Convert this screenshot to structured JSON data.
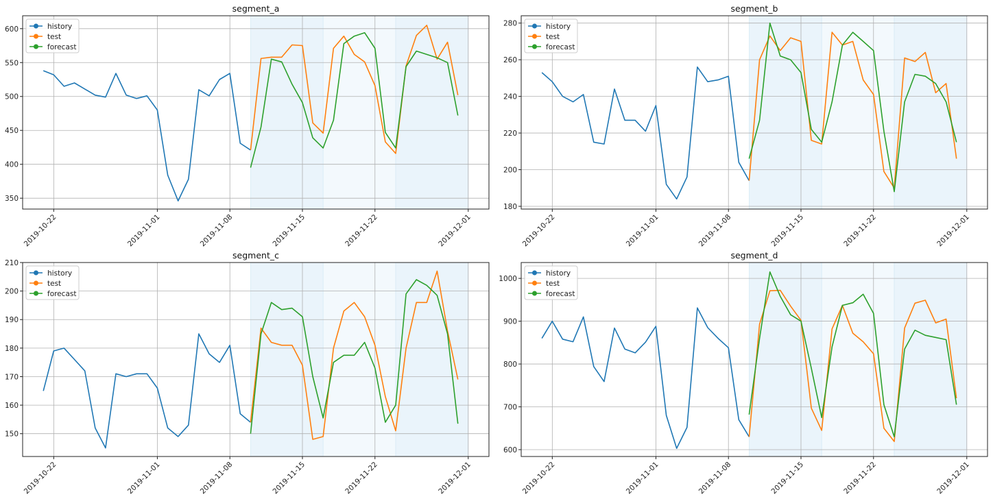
{
  "colors": {
    "history": "#1f77b4",
    "test": "#ff7f0e",
    "forecast": "#2ca02c",
    "fold_a": "#eaf4fb",
    "fold_b": "#f3f9fd",
    "grid": "#b0b0b0"
  },
  "chart_data": [
    {
      "type": "line",
      "title": "segment_a",
      "xlim": [
        "2019-10-19",
        "2019-12-03"
      ],
      "ylim": [
        334,
        619
      ],
      "xticks": [
        "2019-10-22",
        "2019-11-01",
        "2019-11-08",
        "2019-11-15",
        "2019-11-22",
        "2019-12-01"
      ],
      "yticks": [
        350,
        400,
        450,
        500,
        550,
        600
      ],
      "grid": true,
      "legend": "top-left",
      "folds": [
        [
          "2019-11-10",
          "2019-11-17"
        ],
        [
          "2019-11-17",
          "2019-11-24"
        ],
        [
          "2019-11-24",
          "2019-12-01"
        ]
      ],
      "series": [
        {
          "name": "history",
          "start": "2019-10-21",
          "values": [
            538,
            532,
            515,
            520,
            511,
            502,
            499,
            534,
            502,
            497,
            501,
            480,
            384,
            346,
            378,
            510,
            501,
            525,
            534,
            431,
            421
          ]
        },
        {
          "name": "test",
          "start": "2019-11-10",
          "values": [
            421,
            556,
            558,
            558,
            576,
            575,
            461,
            446,
            571,
            589,
            562,
            551,
            516,
            433,
            416,
            545,
            590,
            605,
            555,
            580,
            502
          ]
        },
        {
          "name": "forecast",
          "start": "2019-11-10",
          "values": [
            395,
            455,
            555,
            551,
            518,
            491,
            439,
            424,
            465,
            578,
            589,
            594,
            571,
            447,
            424,
            544,
            567,
            562,
            557,
            550,
            472
          ]
        }
      ]
    },
    {
      "type": "line",
      "title": "segment_b",
      "xlim": [
        "2019-10-19",
        "2019-12-03"
      ],
      "ylim": [
        178.5,
        284
      ],
      "xticks": [
        "2019-10-22",
        "2019-11-01",
        "2019-11-08",
        "2019-11-15",
        "2019-11-22",
        "2019-12-01"
      ],
      "yticks": [
        180,
        200,
        220,
        240,
        260,
        280
      ],
      "grid": true,
      "legend": "top-left",
      "folds": [
        [
          "2019-11-10",
          "2019-11-17"
        ],
        [
          "2019-11-17",
          "2019-11-24"
        ],
        [
          "2019-11-24",
          "2019-12-01"
        ]
      ],
      "series": [
        {
          "name": "history",
          "start": "2019-10-21",
          "values": [
            253,
            248,
            240,
            237,
            241,
            215,
            214,
            244,
            227,
            227,
            221,
            235,
            192,
            184,
            196,
            256,
            248,
            249,
            251,
            204,
            194
          ]
        },
        {
          "name": "test",
          "start": "2019-11-10",
          "values": [
            194,
            260,
            273,
            265,
            272,
            270,
            216,
            214,
            275,
            268,
            270,
            249,
            241,
            199,
            190,
            261,
            259,
            264,
            242,
            247,
            206
          ]
        },
        {
          "name": "forecast",
          "start": "2019-11-10",
          "values": [
            206,
            227,
            280,
            262,
            260,
            253,
            222,
            215,
            237,
            268,
            275,
            270,
            265,
            221,
            188,
            237,
            252,
            251,
            247,
            237,
            215
          ]
        }
      ]
    },
    {
      "type": "line",
      "title": "segment_c",
      "xlim": [
        "2019-10-19",
        "2019-12-03"
      ],
      "ylim": [
        142,
        210
      ],
      "xticks": [
        "2019-10-22",
        "2019-11-01",
        "2019-11-08",
        "2019-11-15",
        "2019-11-22",
        "2019-12-01"
      ],
      "yticks": [
        150,
        160,
        170,
        180,
        190,
        200,
        210
      ],
      "grid": true,
      "legend": "top-left",
      "folds": [
        [
          "2019-11-10",
          "2019-11-17"
        ],
        [
          "2019-11-17",
          "2019-11-24"
        ],
        [
          "2019-11-24",
          "2019-12-01"
        ]
      ],
      "series": [
        {
          "name": "history",
          "start": "2019-10-21",
          "values": [
            165,
            179,
            180,
            176,
            172,
            152,
            145,
            171,
            170,
            171,
            171,
            166,
            152,
            149,
            153,
            185,
            178,
            175,
            181,
            157,
            154
          ]
        },
        {
          "name": "test",
          "start": "2019-11-10",
          "values": [
            154,
            187,
            182,
            181,
            181,
            174,
            148,
            149,
            180,
            193,
            196,
            191,
            181,
            163,
            151,
            180,
            196,
            196,
            207,
            186,
            169
          ]
        },
        {
          "name": "forecast",
          "start": "2019-11-10",
          "values": [
            150,
            185,
            196,
            193.5,
            194,
            191,
            170,
            155.5,
            175,
            177.5,
            177.5,
            182,
            173,
            154,
            160,
            199,
            204,
            202,
            198.5,
            185,
            153.5
          ]
        }
      ]
    },
    {
      "type": "line",
      "title": "segment_d",
      "xlim": [
        "2019-10-19",
        "2019-12-03"
      ],
      "ylim": [
        584,
        1037
      ],
      "xticks": [
        "2019-10-22",
        "2019-11-01",
        "2019-11-08",
        "2019-11-15",
        "2019-11-22",
        "2019-12-01"
      ],
      "yticks": [
        600,
        700,
        800,
        900,
        1000
      ],
      "grid": true,
      "legend": "top-left",
      "folds": [
        [
          "2019-11-10",
          "2019-11-17"
        ],
        [
          "2019-11-17",
          "2019-11-24"
        ],
        [
          "2019-11-24",
          "2019-12-01"
        ]
      ],
      "series": [
        {
          "name": "history",
          "start": "2019-10-21",
          "values": [
            860,
            900,
            858,
            852,
            910,
            794,
            759,
            884,
            835,
            826,
            851,
            888,
            680,
            603,
            652,
            931,
            885,
            860,
            838,
            670,
            630
          ]
        },
        {
          "name": "test",
          "start": "2019-11-10",
          "values": [
            630,
            893,
            971,
            972,
            935,
            902,
            697,
            645,
            882,
            937,
            872,
            852,
            824,
            650,
            619,
            884,
            942,
            949,
            896,
            905,
            720
          ]
        },
        {
          "name": "forecast",
          "start": "2019-11-10",
          "values": [
            682,
            860,
            1015,
            958,
            915,
            900,
            790,
            675,
            840,
            937,
            943,
            963,
            918,
            705,
            630,
            835,
            879,
            867,
            862,
            857,
            705
          ]
        }
      ]
    }
  ]
}
